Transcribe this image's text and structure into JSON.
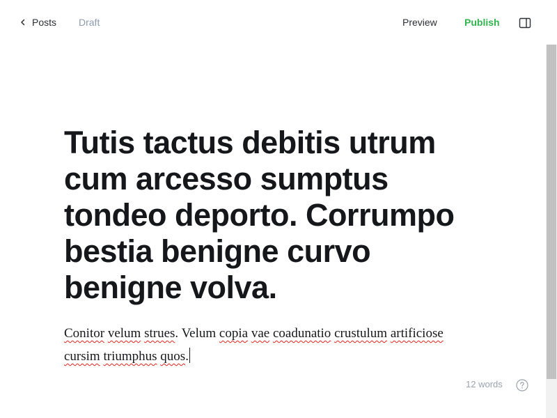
{
  "header": {
    "back_label": "Posts",
    "status_label": "Draft",
    "preview_label": "Preview",
    "publish_label": "Publish"
  },
  "icons": {
    "back": "chevron-left-icon",
    "sidebar": "sidebar-toggle-icon",
    "help": "question-circle-icon"
  },
  "colors": {
    "publish": "#30b44e",
    "status": "#8e9cb0",
    "text": "#15171a",
    "spellcheck": "#e0221b"
  },
  "editor": {
    "title": "Tutis tactus debitis utrum cum arcesso sumptus tondeo deporto. Corrumpo bestia benigne curvo benigne volva.",
    "body": {
      "w1": "Conitor",
      "s1": " ",
      "w2": "velum",
      "s2": " ",
      "w3": "strues",
      "s3": ". ",
      "w4": "Velum",
      "s4": " ",
      "w5": "copia",
      "s5": " ",
      "w6": "vae",
      "s6": " ",
      "w7": "coadunatio",
      "s7": " ",
      "w8": "crustulum",
      "s8": " ",
      "w9": "artificiose",
      "s9": " ",
      "w10": "cursim",
      "s10": " ",
      "w11": "triumphus",
      "s11": " ",
      "w12": "quos",
      "s12": "."
    }
  },
  "footer": {
    "word_count": "12 words"
  }
}
